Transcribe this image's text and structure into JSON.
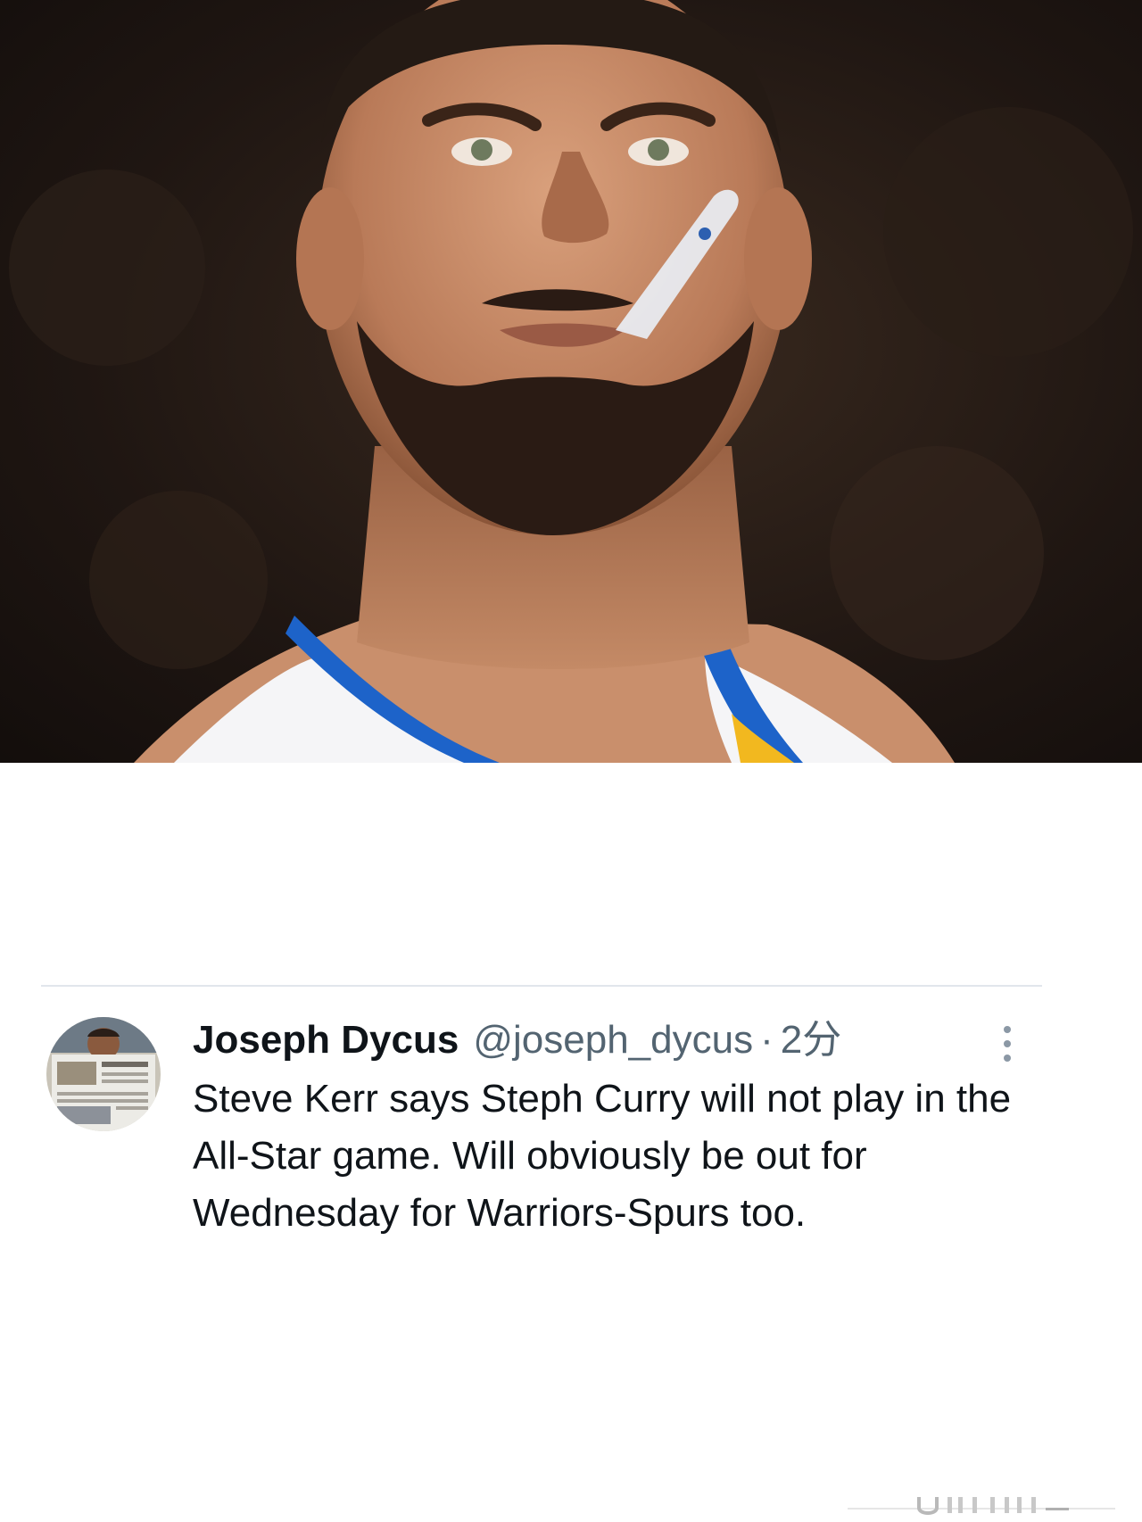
{
  "tweet": {
    "author_name": "Joseph Dycus",
    "author_handle": "@joseph_dycus",
    "separator": "·",
    "timestamp": "2分",
    "text": "Steve Kerr says Steph Curry will not play in the All-Star game. Will obviously be out for Wednesday for Warriors-Spurs too."
  },
  "icons": {
    "more": "more-vertical-icon",
    "avatar": "avatar-newspaper-photo"
  },
  "colors": {
    "name": "#0f1419",
    "secondary": "#536471",
    "divider": "#e1e6ec",
    "jersey_blue": "#1d63c9",
    "jersey_gold": "#f2b81f"
  }
}
